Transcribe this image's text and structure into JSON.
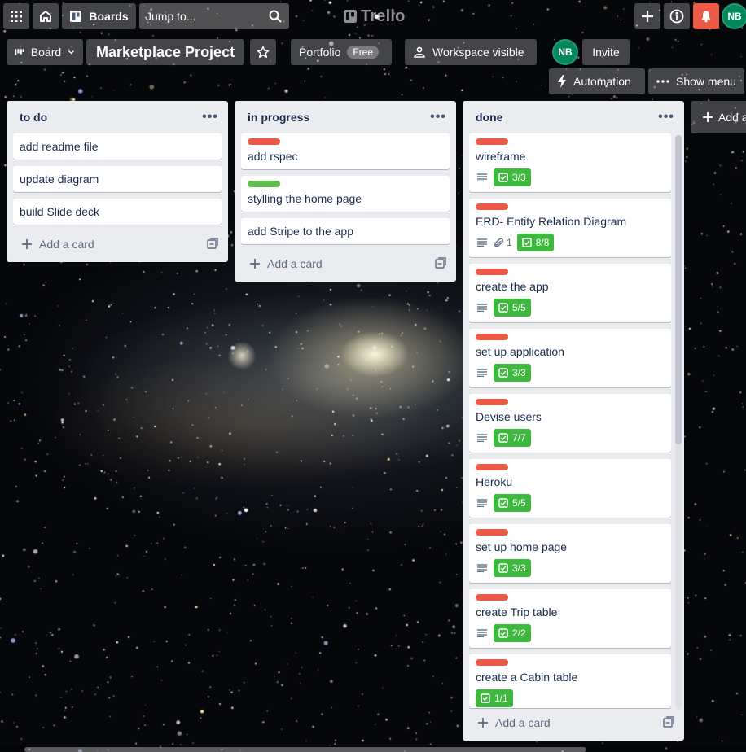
{
  "topbar": {
    "boards_label": "Boards",
    "search_placeholder": "Jump to...",
    "logo_text": "Trello",
    "avatar_initials": "NB"
  },
  "board_header": {
    "view_label": "Board",
    "title": "Marketplace Project",
    "workspace_label": "Portfolio",
    "workspace_plan": "Free",
    "visibility_label": "Workspace visible",
    "member_initials": "NB",
    "invite_label": "Invite",
    "automation_label": "Automation",
    "show_menu_label": "Show menu"
  },
  "colors": {
    "label_red": "#eb5a46",
    "label_green": "#61bd4f",
    "checklist_complete": "#3fb83f",
    "notification_red": "#eb5a46",
    "avatar_green": "#00875a"
  },
  "lists": [
    {
      "title": "to do",
      "add_card_label": "Add a card",
      "cards": [
        {
          "title": "add readme file"
        },
        {
          "title": "update diagram"
        },
        {
          "title": "build Slide deck"
        }
      ]
    },
    {
      "title": "in progress",
      "add_card_label": "Add a card",
      "cards": [
        {
          "title": "add rspec",
          "label": "red"
        },
        {
          "title": "stylling the home page",
          "label": "green"
        },
        {
          "title": "add Stripe to the app"
        }
      ]
    },
    {
      "title": "done",
      "add_card_label": "Add a card",
      "cards": [
        {
          "title": "wireframe",
          "label": "red",
          "description": true,
          "checklist": "3/3"
        },
        {
          "title": "ERD- Entity Relation Diagram",
          "label": "red",
          "description": true,
          "attachments": "1",
          "checklist": "8/8"
        },
        {
          "title": "create the app",
          "label": "red",
          "description": true,
          "checklist": "5/5"
        },
        {
          "title": "set up application",
          "label": "red",
          "description": true,
          "checklist": "3/3"
        },
        {
          "title": "Devise users",
          "label": "red",
          "description": true,
          "checklist": "7/7"
        },
        {
          "title": "Heroku",
          "label": "red",
          "description": true,
          "checklist": "5/5"
        },
        {
          "title": "set up home page",
          "label": "red",
          "description": true,
          "checklist": "3/3"
        },
        {
          "title": "create Trip table",
          "label": "red",
          "description": true,
          "checklist": "2/2"
        },
        {
          "title": "create a Cabin table",
          "label": "red",
          "checklist": "1/1"
        }
      ]
    }
  ],
  "add_list_label": "Add a"
}
